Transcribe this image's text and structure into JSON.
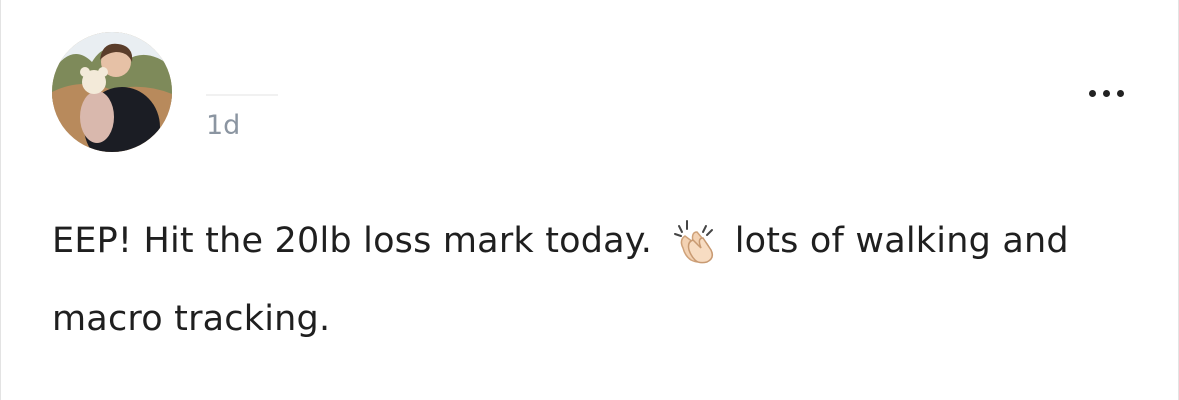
{
  "post": {
    "timestamp": "1d",
    "text_before_icon": "EEP! Hit the 20lb loss mark today. ",
    "icon": "clapping-hands-icon",
    "text_after_icon": " lots of walking and macro tracking."
  },
  "colors": {
    "text": "#1f1f1f",
    "timestamp": "#8b95a1",
    "menu_dots": "#222222"
  }
}
